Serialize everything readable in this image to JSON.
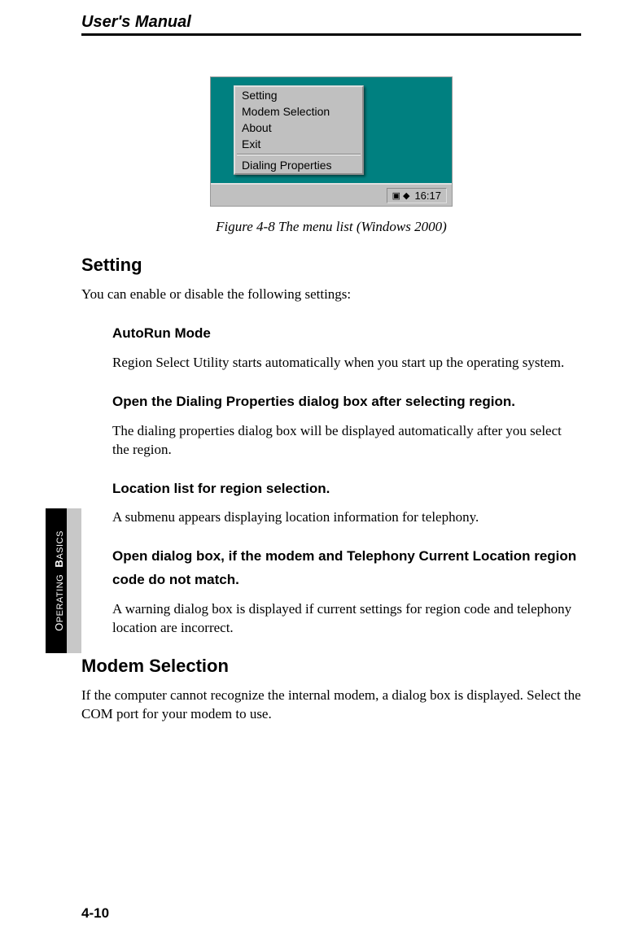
{
  "header": {
    "title": "User's Manual"
  },
  "figure": {
    "menu_items": {
      "setting": "Setting",
      "modem_selection": "Modem Selection",
      "about": "About",
      "exit": "Exit",
      "dialing_properties": "Dialing Properties"
    },
    "taskbar": {
      "time": "16:17"
    },
    "caption": "Figure 4-8  The menu list (Windows 2000)"
  },
  "sections": {
    "setting": {
      "heading": "Setting",
      "intro": "You can enable or disable the following settings:",
      "sub": {
        "autorun": {
          "heading": "AutoRun Mode",
          "text": "Region Select Utility starts automatically when you start up the operating system."
        },
        "dialing": {
          "heading": "Open the Dialing Properties dialog box after selecting region.",
          "text": "The dialing properties dialog box will be displayed automatically after you select the region."
        },
        "location": {
          "heading": "Location list for region selection.",
          "text": "A submenu appears displaying location information for telephony."
        },
        "mismatch": {
          "heading": "Open dialog box, if the modem and Telephony Current Location region code do not match.",
          "text": "A warning dialog box is displayed if current settings for region code and telephony location are incorrect."
        }
      }
    },
    "modem_selection": {
      "heading": "Modem Selection",
      "text": "If the computer cannot recognize the internal modem, a dialog box is displayed. Select the COM port for your modem to use."
    }
  },
  "side_tab": {
    "prefix": "O",
    "word1": "PERATING",
    "bold_prefix": "B",
    "word2": "ASICS"
  },
  "page_number": "4-10"
}
